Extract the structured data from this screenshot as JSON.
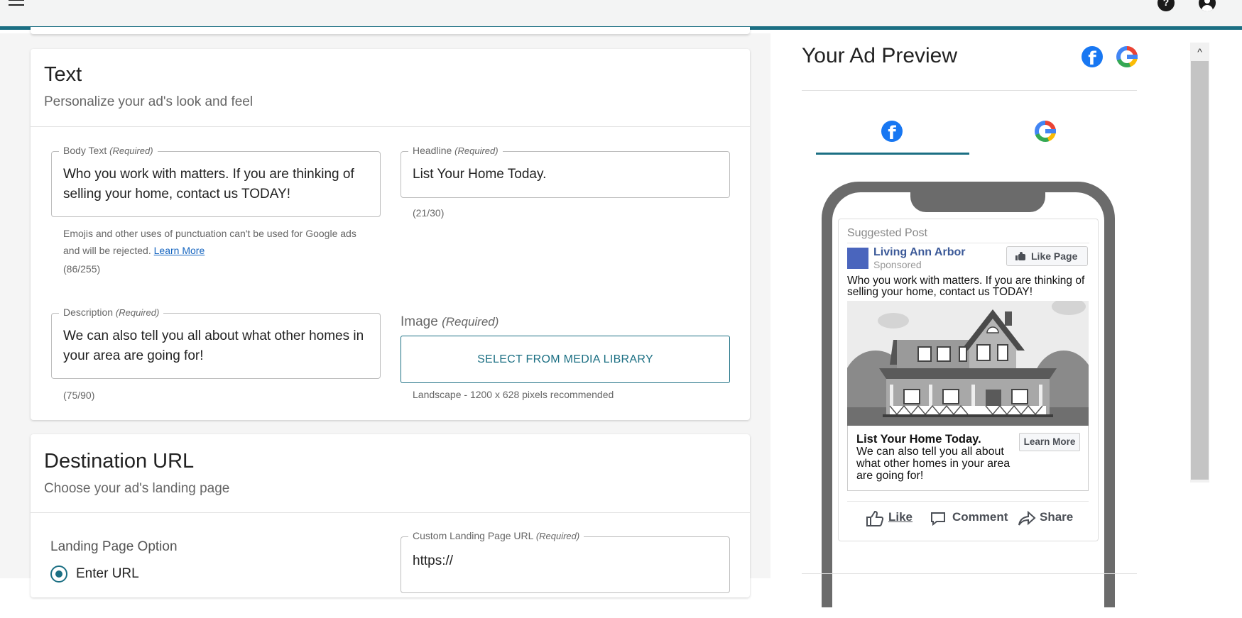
{
  "appbar": {
    "menu_icon": "hamburger-icon",
    "help_icon": "help-circle-icon",
    "help_glyph": "?",
    "account_icon": "account-circle-icon"
  },
  "text_section": {
    "title": "Text",
    "subtitle": "Personalize your ad's look and feel",
    "body_text": {
      "label": "Body Text",
      "required": "(Required)",
      "value": "Who you work with matters. If you are thinking of selling your home, contact us TODAY!",
      "note": "Emojis and other uses of punctuation can't be used for Google ads and will be rejected.",
      "note_link": "Learn More",
      "count": "(86/255)"
    },
    "headline": {
      "label": "Headline",
      "required": "(Required)",
      "value": "List Your Home Today.",
      "count": "(21/30)"
    },
    "description": {
      "label": "Description",
      "required": "(Required)",
      "value": "We can also tell you all about what other homes in your area are going for!",
      "count": "(75/90)"
    },
    "image": {
      "label": "Image",
      "required": "(Required)",
      "button_label": "SELECT FROM MEDIA LIBRARY",
      "hint": "Landscape - 1200 x 628 pixels recommended"
    }
  },
  "destination_section": {
    "title": "Destination URL",
    "subtitle": "Choose your ad's landing page",
    "landing_option_label": "Landing Page Option",
    "radio_label": "Enter URL",
    "custom_url": {
      "label": "Custom Landing Page URL",
      "required": "(Required)",
      "value": "https://"
    }
  },
  "preview": {
    "title": "Your Ad Preview",
    "header_icons": [
      "facebook-icon",
      "google-icon"
    ],
    "tabs": [
      {
        "name": "facebook",
        "icon": "facebook-icon",
        "active": true
      },
      {
        "name": "google",
        "icon": "google-icon",
        "active": false
      }
    ],
    "fb_glyph": "f",
    "post": {
      "suggested": "Suggested Post",
      "page_name": "Living Ann Arbor",
      "sponsored": "Sponsored",
      "like_page": "Like Page",
      "body": "Who you work with matters. If you are thinking of selling your home, contact us TODAY!",
      "headline": "List Your Home Today.",
      "description": "We can also tell you all about what other homes in your area are going for!",
      "cta": "Learn More",
      "actions": [
        "Like",
        "Comment",
        "Share"
      ]
    }
  },
  "scrollbar": {
    "up_glyph": "^"
  },
  "colors": {
    "accent": "#1b6f83",
    "facebook_blue": "#1877f2",
    "fb_page_name": "#3b5998"
  }
}
